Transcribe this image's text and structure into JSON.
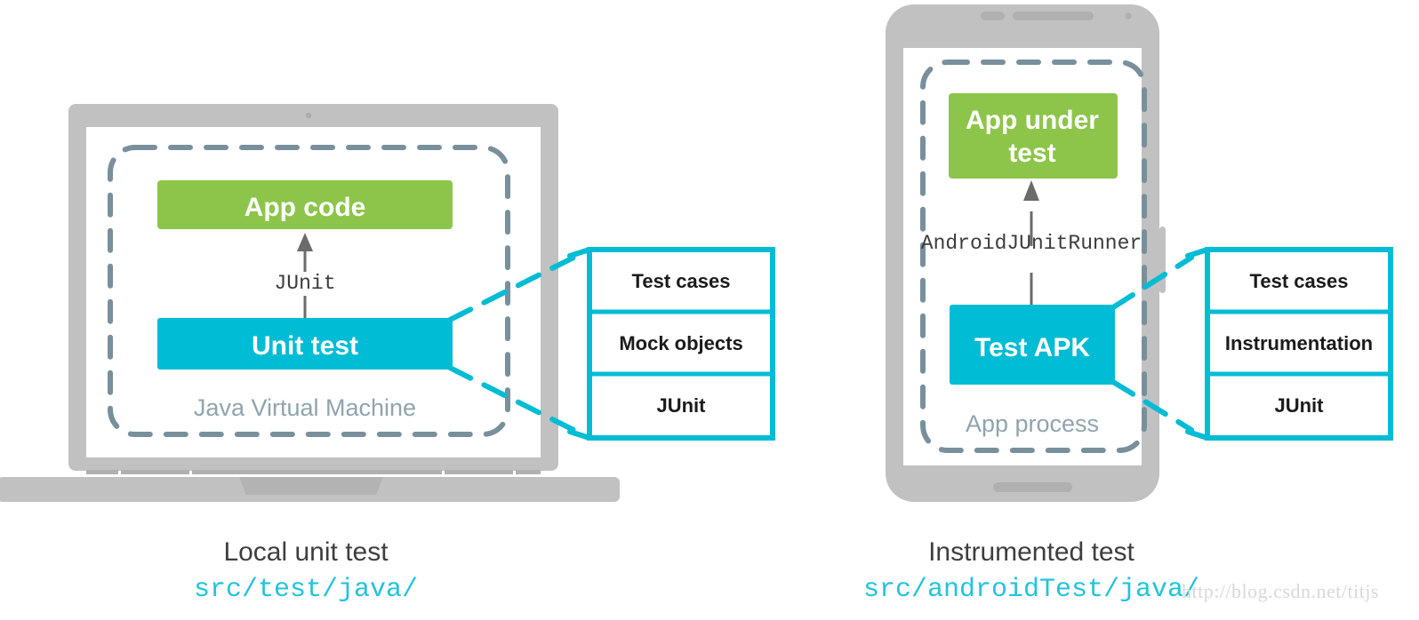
{
  "diagram": {
    "title": "Android test types diagram",
    "colors": {
      "green": "#8dc54a",
      "cyan": "#00bcd4",
      "callout_stroke": "#00bcd4",
      "dashed_container": "#78909c",
      "device_gray": "#c1c1c1",
      "arrow_gray": "#6b6b6b",
      "caption_text": "#3e3e3e",
      "caption_path": "#22c3dd",
      "container_label": "#90a4ae",
      "watermark": "#d8d8d8"
    }
  },
  "left_panel": {
    "device": "laptop",
    "container_label": "Java Virtual Machine",
    "app_box_label": "App code",
    "test_box_label": "Unit test",
    "arrow_label": "JUnit",
    "caption_title": "Local unit test",
    "caption_path": "src/test/java/",
    "callout": {
      "items": [
        "Test cases",
        "Mock objects",
        "JUnit"
      ]
    }
  },
  "right_panel": {
    "device": "phone",
    "container_label": "App process",
    "app_box_label": "App under\ntest",
    "app_box_label_line1": "App under",
    "app_box_label_line2": "test",
    "test_box_label": "Test APK",
    "arrow_label": "AndroidJUnitRunner",
    "caption_title": "Instrumented test",
    "caption_path": "src/androidTest/java/",
    "callout": {
      "items": [
        "Test cases",
        "Instrumentation",
        "JUnit"
      ]
    }
  },
  "watermark": {
    "text": "http://blog.csdn.net/titjs"
  }
}
